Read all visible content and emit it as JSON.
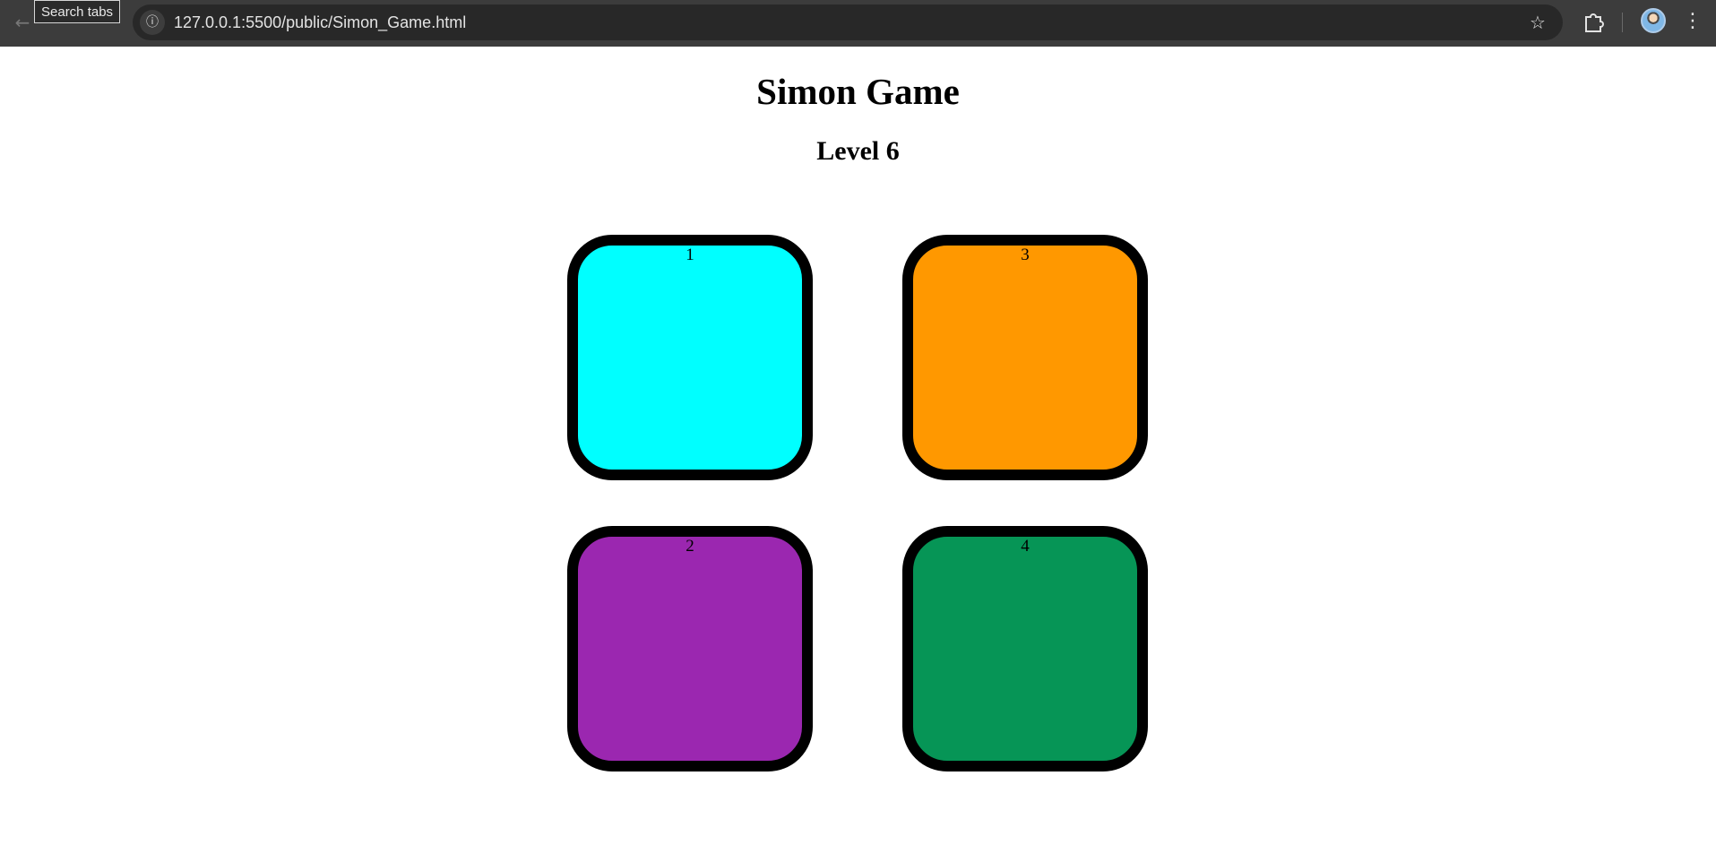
{
  "browser": {
    "tooltip": "Search tabs",
    "url": "127.0.0.1:5500/public/Simon_Game.html",
    "icons": {
      "back": "arrow-left-icon",
      "site_info": "info-icon",
      "bookmark": "star-icon",
      "extensions": "puzzle-icon",
      "profile": "avatar",
      "menu": "kebab-menu-icon"
    }
  },
  "page": {
    "title": "Simon Game",
    "level": "Level 6"
  },
  "buttons": [
    {
      "label": "1",
      "color": "#00ffff"
    },
    {
      "label": "3",
      "color": "#ff9800"
    },
    {
      "label": "2",
      "color": "#9b27b0"
    },
    {
      "label": "4",
      "color": "#069556"
    }
  ]
}
